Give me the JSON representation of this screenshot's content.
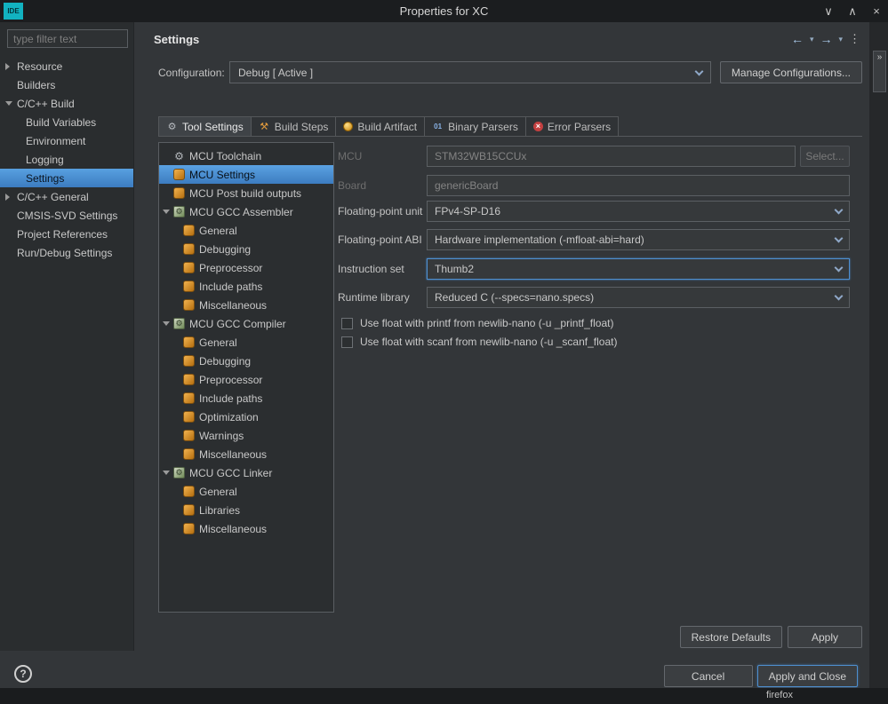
{
  "colors": {
    "selection_blue": "#4a90d8",
    "accent_blue": "#4e8fd0",
    "icon_orange": "#e0962e",
    "titlebar_teal": "#12b2c0",
    "error_red": "#c34040"
  },
  "window": {
    "logo": "IDE",
    "title": "Properties for XC",
    "shade_glyph": "∨",
    "unshade_glyph": "∧",
    "close_glyph": "×"
  },
  "taskbar": {
    "app": "firefox"
  },
  "overflow_button": "»",
  "sidebar": {
    "filter_placeholder": "type filter text",
    "items": [
      {
        "label": "Resource",
        "depth": 0,
        "arrow": "collapsed"
      },
      {
        "label": "Builders",
        "depth": 0
      },
      {
        "label": "C/C++ Build",
        "depth": 0,
        "arrow": "expanded"
      },
      {
        "label": "Build Variables",
        "depth": 1
      },
      {
        "label": "Environment",
        "depth": 1
      },
      {
        "label": "Logging",
        "depth": 1
      },
      {
        "label": "Settings",
        "depth": 1,
        "selected": true
      },
      {
        "label": "C/C++ General",
        "depth": 0,
        "arrow": "collapsed"
      },
      {
        "label": "CMSIS-SVD Settings",
        "depth": 0
      },
      {
        "label": "Project References",
        "depth": 0
      },
      {
        "label": "Run/Debug Settings",
        "depth": 0
      }
    ]
  },
  "header": {
    "title": "Settings",
    "back_glyph": "←",
    "forward_glyph": "→",
    "menu_chevron": "▾",
    "view_menu_glyph": "⋮"
  },
  "configuration": {
    "label": "Configuration:",
    "value": "Debug  [ Active ]",
    "manage_button": "Manage Configurations..."
  },
  "tabs": [
    {
      "label": "Tool Settings",
      "icon": "wrench",
      "active": true
    },
    {
      "label": "Build Steps",
      "icon": "hammer"
    },
    {
      "label": "Build Artifact",
      "icon": "artifact"
    },
    {
      "label": "Binary Parsers",
      "icon": "binary"
    },
    {
      "label": "Error Parsers",
      "icon": "error"
    }
  ],
  "tool_tree": [
    {
      "label": "MCU Toolchain",
      "depth": 0,
      "icon": "toolchain"
    },
    {
      "label": "MCU Settings",
      "depth": 0,
      "icon": "orange",
      "selected": true
    },
    {
      "label": "MCU Post build outputs",
      "depth": 0,
      "icon": "orange"
    },
    {
      "label": "MCU GCC Assembler",
      "depth": 0,
      "icon": "gear",
      "arrow": "expanded"
    },
    {
      "label": "General",
      "depth": 1,
      "icon": "orange"
    },
    {
      "label": "Debugging",
      "depth": 1,
      "icon": "orange"
    },
    {
      "label": "Preprocessor",
      "depth": 1,
      "icon": "orange"
    },
    {
      "label": "Include paths",
      "depth": 1,
      "icon": "orange"
    },
    {
      "label": "Miscellaneous",
      "depth": 1,
      "icon": "orange"
    },
    {
      "label": "MCU GCC Compiler",
      "depth": 0,
      "icon": "gear",
      "arrow": "expanded"
    },
    {
      "label": "General",
      "depth": 1,
      "icon": "orange"
    },
    {
      "label": "Debugging",
      "depth": 1,
      "icon": "orange"
    },
    {
      "label": "Preprocessor",
      "depth": 1,
      "icon": "orange"
    },
    {
      "label": "Include paths",
      "depth": 1,
      "icon": "orange"
    },
    {
      "label": "Optimization",
      "depth": 1,
      "icon": "orange"
    },
    {
      "label": "Warnings",
      "depth": 1,
      "icon": "orange"
    },
    {
      "label": "Miscellaneous",
      "depth": 1,
      "icon": "orange"
    },
    {
      "label": "MCU GCC Linker",
      "depth": 0,
      "icon": "gear",
      "arrow": "expanded"
    },
    {
      "label": "General",
      "depth": 1,
      "icon": "orange"
    },
    {
      "label": "Libraries",
      "depth": 1,
      "icon": "orange"
    },
    {
      "label": "Miscellaneous",
      "depth": 1,
      "icon": "orange"
    }
  ],
  "form": {
    "mcu": {
      "label": "MCU",
      "value": "STM32WB15CCUx",
      "button": "Select..."
    },
    "board": {
      "label": "Board",
      "value": "genericBoard"
    },
    "fpu": {
      "label": "Floating-point unit",
      "value": "FPv4-SP-D16"
    },
    "fabi": {
      "label": "Floating-point ABI",
      "value": "Hardware implementation (-mfloat-abi=hard)"
    },
    "iset": {
      "label": "Instruction set",
      "value": "Thumb2"
    },
    "runtime": {
      "label": "Runtime library",
      "value": "Reduced C (--specs=nano.specs)"
    },
    "checkboxes": [
      {
        "label": "Use float with printf from newlib-nano (-u _printf_float)",
        "checked": false
      },
      {
        "label": "Use float with scanf from newlib-nano (-u _scanf_float)",
        "checked": false
      }
    ]
  },
  "buttons": {
    "restore_defaults": "Restore Defaults",
    "apply": "Apply",
    "cancel": "Cancel",
    "apply_and_close": "Apply and Close"
  },
  "help_glyph": "?"
}
